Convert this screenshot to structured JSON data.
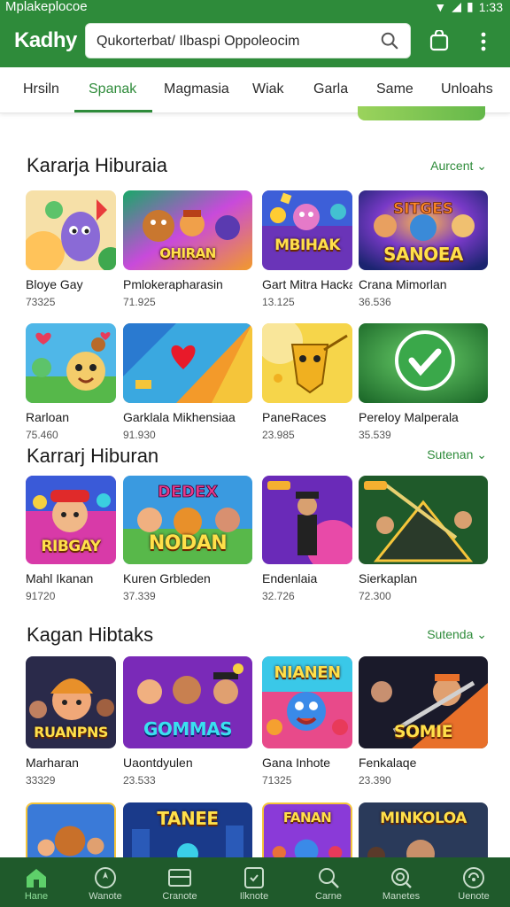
{
  "status": {
    "app": "Mplakeplocoe",
    "time": "1:33"
  },
  "header": {
    "brand": "Kadhy",
    "search_value": "Qukorterbat/ Ilbaspi Oppoleocim"
  },
  "tabs": [
    {
      "label": "Hrsiln"
    },
    {
      "label": "Spanak"
    },
    {
      "label": "Magmasia"
    },
    {
      "label": "Wiak"
    },
    {
      "label": "Garla"
    },
    {
      "label": "Same"
    },
    {
      "label": "Unloahs"
    }
  ],
  "sections": [
    {
      "title": "Kararja Hiburaia",
      "link": "Aurcent ⌄",
      "rows": [
        [
          {
            "name": "Bloye Gay",
            "count": "73325",
            "art": ""
          },
          {
            "name": "Pmlokerapharasin",
            "count": "71.925",
            "art": "OHIRAN"
          },
          {
            "name": "Gart Mitra Hacka",
            "count": "13.125",
            "art": "MBIHAK"
          },
          {
            "name": "Crana Mimorlan",
            "count": "36.536",
            "art": "SANOEA"
          }
        ],
        [
          {
            "name": "Rarloan",
            "count": "75.460",
            "art": ""
          },
          {
            "name": "Garklala Mikhensiaa",
            "count": "91.930",
            "art": ""
          },
          {
            "name": "PaneRaces",
            "count": "23.985",
            "art": ""
          },
          {
            "name": "Pereloy Malperala",
            "count": "35.539",
            "art": ""
          }
        ]
      ]
    },
    {
      "title": "Karrarj Hiburan",
      "link": "Sutenan ⌄",
      "rows": [
        [
          {
            "name": "Mahl Ikanan",
            "count": "91720",
            "art": "RIBGAY"
          },
          {
            "name": "Kuren Grbleden",
            "count": "37.339",
            "art": "NODAN"
          },
          {
            "name": "Endenlaia",
            "count": "32.726",
            "art": ""
          },
          {
            "name": "Sierkaplan",
            "count": "72.300",
            "art": ""
          }
        ]
      ]
    },
    {
      "title": "Kagan Hibtaks",
      "link": "Sutenda ⌄",
      "rows": [
        [
          {
            "name": "Marharan",
            "count": "33329",
            "art": "RUANPNS"
          },
          {
            "name": "Uaontdyulen",
            "count": "23.533",
            "art": "GOMMAS"
          },
          {
            "name": "Gana Inhote",
            "count": "71325",
            "art": "NIANEN"
          },
          {
            "name": "Fenkalaqe",
            "count": "23.390",
            "art": "SOMIE"
          }
        ]
      ]
    }
  ],
  "peek_row": [
    {
      "art": ""
    },
    {
      "art": "TANEE"
    },
    {
      "art": "FANAN"
    },
    {
      "art": "MINKOLOA"
    }
  ],
  "bottom_nav": [
    {
      "label": "Hane",
      "icon": "home-icon"
    },
    {
      "label": "Wanote",
      "icon": "compass-icon"
    },
    {
      "label": "Cranote",
      "icon": "card-icon"
    },
    {
      "label": "Ilknote",
      "icon": "tag-icon"
    },
    {
      "label": "Carne",
      "icon": "search-icon"
    },
    {
      "label": "Manetes",
      "icon": "magnifier-icon"
    },
    {
      "label": "Uenote",
      "icon": "settings-icon"
    }
  ],
  "colors": {
    "brand_green": "#2e8b3a",
    "nav_green": "#1f5a2b"
  }
}
